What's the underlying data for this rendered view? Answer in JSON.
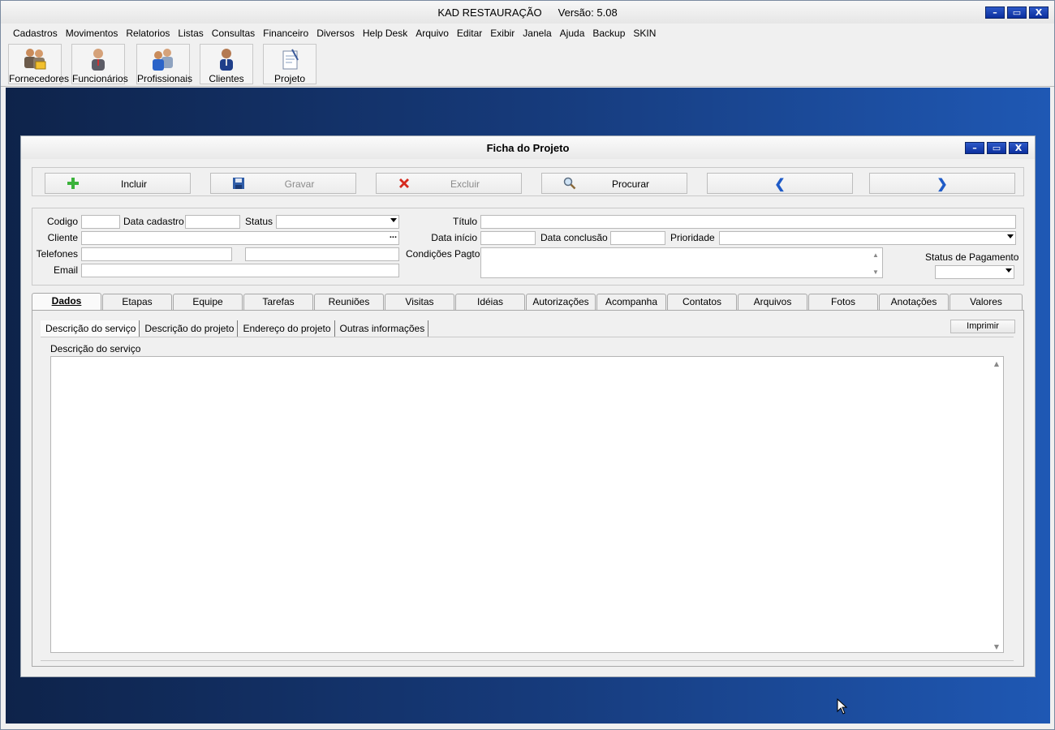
{
  "app": {
    "title": "KAD RESTAURAÇÃO",
    "version": "Versão: 5.08",
    "window_buttons": [
      "–",
      "▭",
      "X"
    ]
  },
  "menu": [
    "Cadastros",
    "Movimentos",
    "Relatorios",
    "Listas",
    "Consultas",
    "Financeiro",
    "Diversos",
    "Help Desk",
    "Arquivo",
    "Editar",
    "Exibir",
    "Janela",
    "Ajuda",
    "Backup",
    "SKIN"
  ],
  "toolbar": [
    {
      "label": "Fornecedores",
      "icon": "suppliers-icon"
    },
    {
      "label": "Funcionários",
      "icon": "employee-icon"
    },
    {
      "label": "Profissionais",
      "icon": "professionals-icon"
    },
    {
      "label": "Clientes",
      "icon": "client-icon"
    },
    {
      "label": "Projeto",
      "icon": "project-icon"
    }
  ],
  "child": {
    "title": "Ficha do Projeto",
    "window_buttons": [
      "–",
      "▭",
      "X"
    ]
  },
  "actions": {
    "incluir": "Incluir",
    "gravar": "Gravar",
    "excluir": "Excluir",
    "procurar": "Procurar",
    "prev": "❮",
    "next": "❯"
  },
  "form": {
    "codigo_label": "Codigo",
    "codigo_value": "",
    "data_cadastro_label": "Data cadastro",
    "data_cadastro_value": "",
    "status_label": "Status",
    "status_value": "",
    "cliente_label": "Cliente",
    "cliente_value": "",
    "cliente_btn": "...",
    "telefones_label": "Telefones",
    "telefone1_value": "",
    "telefone2_value": "",
    "email_label": "Email",
    "email_value": "",
    "titulo_label": "Título",
    "titulo_value": "",
    "data_inicio_label": "Data início",
    "data_inicio_value": "",
    "data_conclusao_label": "Data conclusão",
    "data_conclusao_value": "",
    "prioridade_label": "Prioridade",
    "prioridade_value": "",
    "condicoes_label": "Condições Pagto",
    "condicoes_value": "",
    "status_pagamento_label": "Status de Pagamento",
    "status_pagamento_value": ""
  },
  "tabs": [
    "Dados",
    "Etapas",
    "Equipe",
    "Tarefas",
    "Reuniões",
    "Visitas",
    "Idéias",
    "Autorizações",
    "Acompanha",
    "Contatos",
    "Arquivos",
    "Fotos",
    "Anotações",
    "Valores"
  ],
  "active_tab": "Dados",
  "subtabs": [
    "Descrição do serviço",
    "Descrição do projeto",
    "Endereço do projeto",
    "Outras informações"
  ],
  "active_subtab": "Descrição do serviço",
  "print_label": "Imprimir",
  "description": {
    "label": "Descrição do serviço",
    "value": ""
  }
}
